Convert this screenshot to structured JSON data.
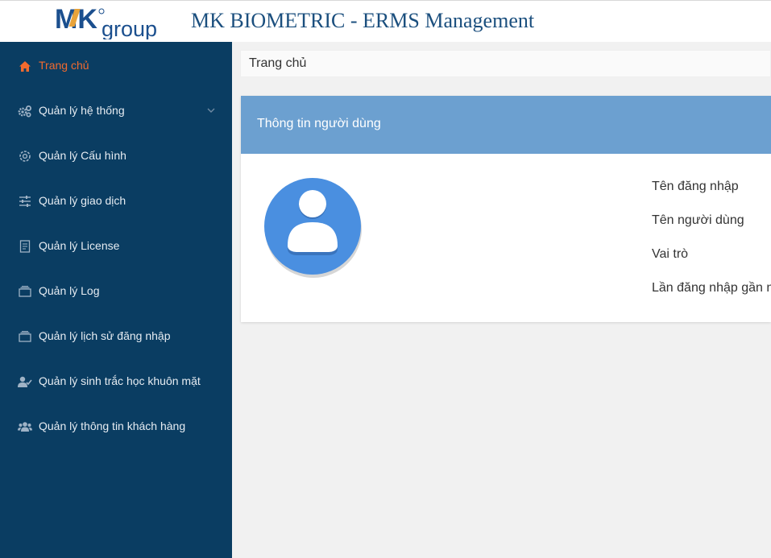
{
  "header": {
    "logo_text_mk": "MK",
    "logo_text_group": "group",
    "title": "MK BIOMETRIC - ERMS Management"
  },
  "sidebar": {
    "items": [
      {
        "label": "Trang chủ",
        "icon": "home-icon",
        "active": true
      },
      {
        "label": "Quản lý hệ thống",
        "icon": "gears-icon",
        "has_submenu": true
      },
      {
        "label": "Quản lý Cấu hình",
        "icon": "gear-icon"
      },
      {
        "label": "Quản lý giao dịch",
        "icon": "sliders-icon"
      },
      {
        "label": "Quản lý License",
        "icon": "document-icon"
      },
      {
        "label": "Quản lý Log",
        "icon": "archive-icon"
      },
      {
        "label": "Quản lý lịch sử đăng nhập",
        "icon": "archive-icon"
      },
      {
        "label": "Quản lý sinh trắc học khuôn mặt",
        "icon": "user-check-icon"
      },
      {
        "label": "Quản lý thông tin khách hàng",
        "icon": "users-icon"
      }
    ]
  },
  "breadcrumb": {
    "current": "Trang chủ"
  },
  "user_card": {
    "title": "Thông tin người dùng",
    "fields": [
      {
        "label": "Tên đăng nhập"
      },
      {
        "label": "Tên người dùng"
      },
      {
        "label": "Vai trò"
      },
      {
        "label": "Lần đăng nhập gần nhất"
      }
    ]
  },
  "colors": {
    "sidebar_bg": "#0a3d62",
    "active_accent": "#f26a2e",
    "card_header_bg": "#6ca0d0",
    "title_color": "#1b4f7e",
    "avatar_blue": "#4a8fe0"
  }
}
